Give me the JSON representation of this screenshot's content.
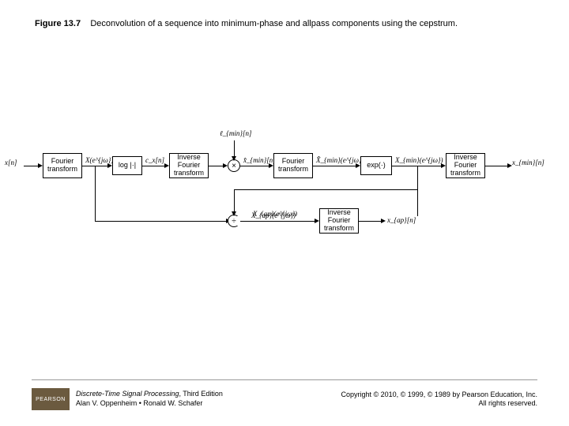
{
  "figure": {
    "number": "Figure 13.7",
    "caption": "Deconvolution of a sequence into minimum-phase and allpass components using the cepstrum."
  },
  "diagram": {
    "input": "x[n]",
    "blocks": {
      "ft1": "Fourier\ntransform",
      "log": "log |·|",
      "ift1": "Inverse\nFourier\ntransform",
      "ft2": "Fourier\ntransform",
      "exp": "exp(·)",
      "ift2": "Inverse\nFourier\ntransform",
      "ift3": "Inverse\nFourier\ntransform"
    },
    "signals": {
      "Xejw": "X(e^{jω})",
      "cxn": "c_x[n]",
      "lmin": "ℓ_{min}[n]",
      "xhatmin": "x̂_{min}[n]",
      "Xhatmin": "X̂_{min}(e^{jω})",
      "Xminejw": "X_{min}(e^{jω})",
      "xminout": "x_{min}[n]",
      "Xapejw": "X_{ap}(e^{jω})",
      "xapn": "x_{ap}[n]"
    },
    "ops": {
      "mult": "×",
      "div": "÷"
    }
  },
  "footer": {
    "logo": "PEARSON",
    "book_title": "Discrete-Time Signal Processing",
    "edition": ", Third Edition",
    "authors": "Alan V. Oppenheim • Ronald W. Schafer",
    "copyright": "Copyright © 2010, © 1999, © 1989 by Pearson Education, Inc.",
    "rights": "All rights reserved."
  }
}
